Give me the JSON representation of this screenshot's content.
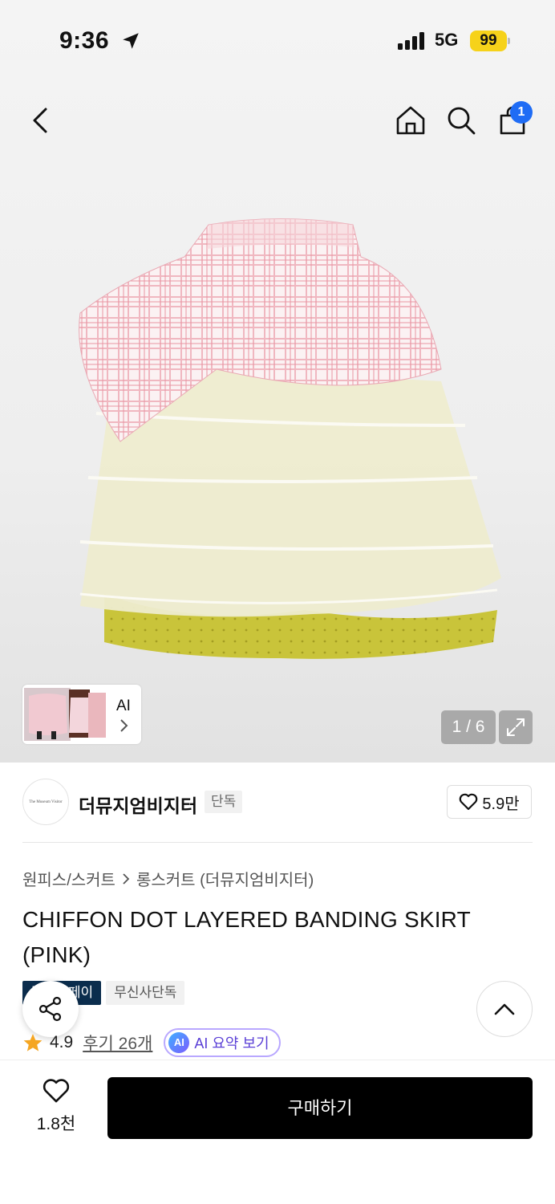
{
  "status_bar": {
    "time": "9:36",
    "network": "5G",
    "battery": "99"
  },
  "header": {
    "cart_count": "1"
  },
  "gallery": {
    "counter": "1 / 6",
    "thumb_ai_label": "AI"
  },
  "brand": {
    "logo_text": "The Museum Visitor",
    "name": "더뮤지엄비지터",
    "tag": "단독",
    "likes": "5.9만"
  },
  "breadcrumb": {
    "category": "원피스/스커트",
    "subcategory": "롱스커트 (더뮤지엄비지터)"
  },
  "product": {
    "title": "CHIFFON DOT LAYERED BANDING SKIRT (PINK)",
    "badge_pay": "무신사페이",
    "badge_exclusive": "무신사단독",
    "rating": "4.9",
    "reviews": "후기 26개",
    "ai_summary": "AI 요약 보기",
    "ai_icon_text": "AI"
  },
  "bottom": {
    "wish_count": "1.8천",
    "buy_label": "구매하기"
  },
  "colors": {
    "accent_blue": "#1f6cf5",
    "pay_badge": "#0b2d4d",
    "star": "#f5a623",
    "ai_purple": "#5a3fd6"
  }
}
